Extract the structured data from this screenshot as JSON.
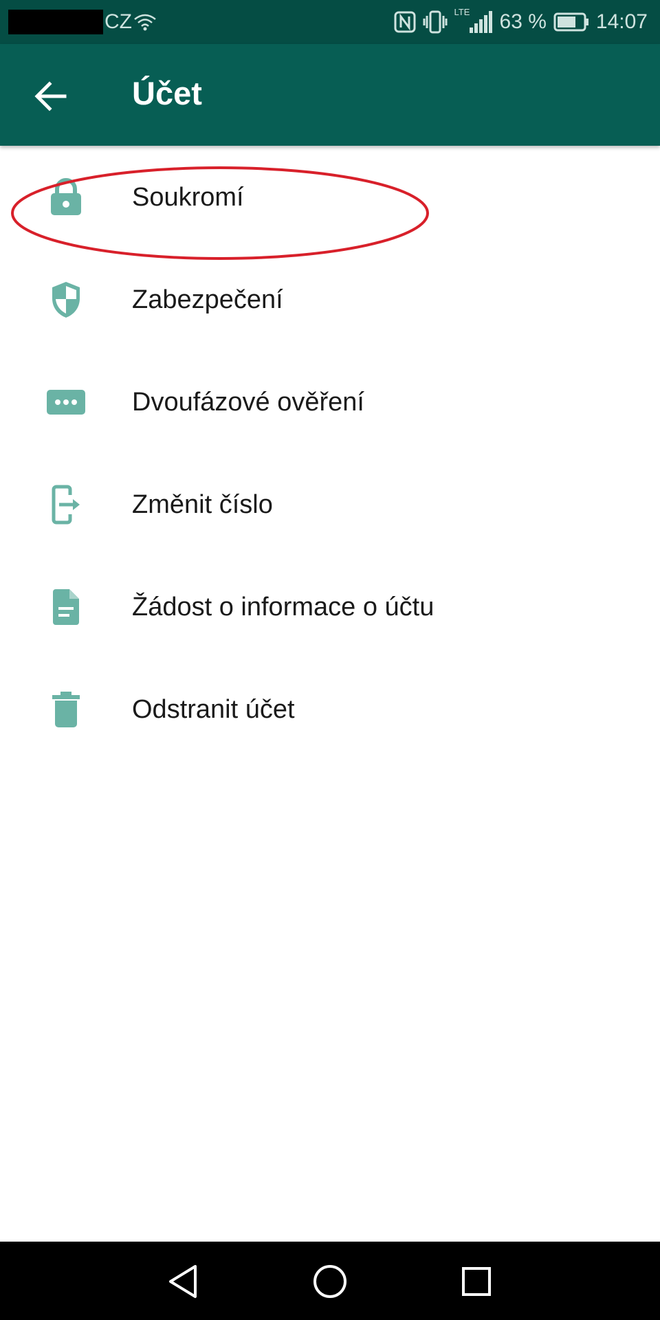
{
  "status_bar": {
    "carrier": "CZ",
    "battery_text": "63 %",
    "network_type": "LTE",
    "time": "14:07"
  },
  "toolbar": {
    "title": "Účet"
  },
  "menu": {
    "items": [
      {
        "label": "Soukromí",
        "icon": "lock-icon"
      },
      {
        "label": "Zabezpečení",
        "icon": "shield-icon"
      },
      {
        "label": "Dvoufázové ověření",
        "icon": "dots-icon"
      },
      {
        "label": "Změnit číslo",
        "icon": "change-number-icon"
      },
      {
        "label": "Žádost o informace o účtu",
        "icon": "document-icon"
      },
      {
        "label": "Odstranit účet",
        "icon": "trash-icon"
      }
    ]
  },
  "colors": {
    "status_bar": "#054d44",
    "toolbar": "#075e54",
    "icon_tint": "#6ab3a5",
    "highlight": "#d8202a"
  }
}
